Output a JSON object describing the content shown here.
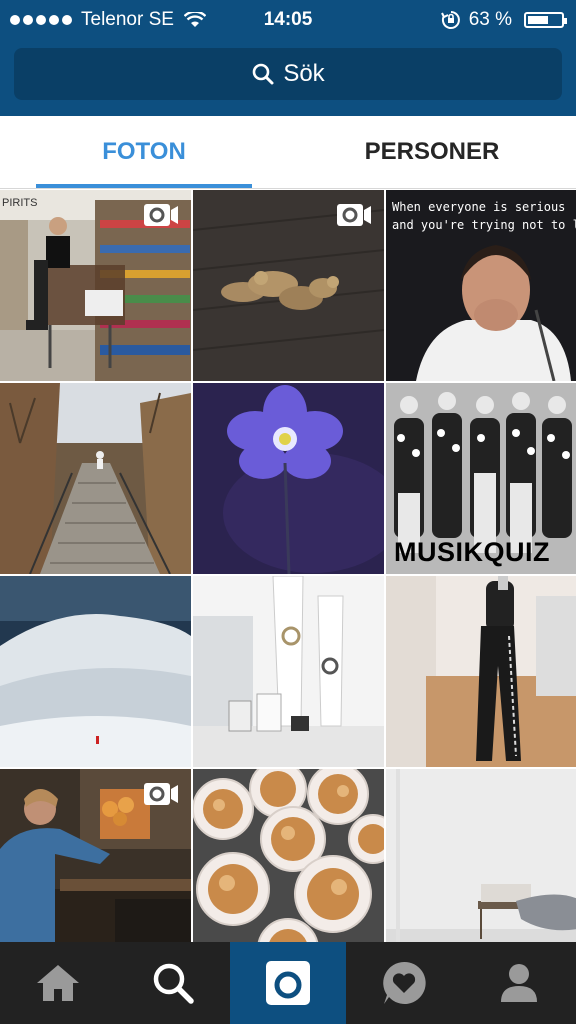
{
  "status": {
    "carrier": "Telenor SE",
    "time": "14:05",
    "battery": "63 %",
    "battery_level": 0.63
  },
  "search": {
    "label": "Sök"
  },
  "tabs": [
    {
      "label": "FOTON",
      "active": true
    },
    {
      "label": "PERSONER",
      "active": false
    }
  ],
  "grid": {
    "captions": {
      "meme": "When everyone is serious\nand you're trying not to laugh",
      "musikquiz": "MUSIKQUIZ"
    }
  },
  "colors": {
    "header": "#0d4f80",
    "accent": "#3a8fd9",
    "nav": "#222222"
  },
  "nav": {
    "items": [
      "home-icon",
      "search-icon",
      "camera-icon",
      "activity-heart-icon",
      "profile-icon"
    ],
    "active": "search-icon"
  }
}
